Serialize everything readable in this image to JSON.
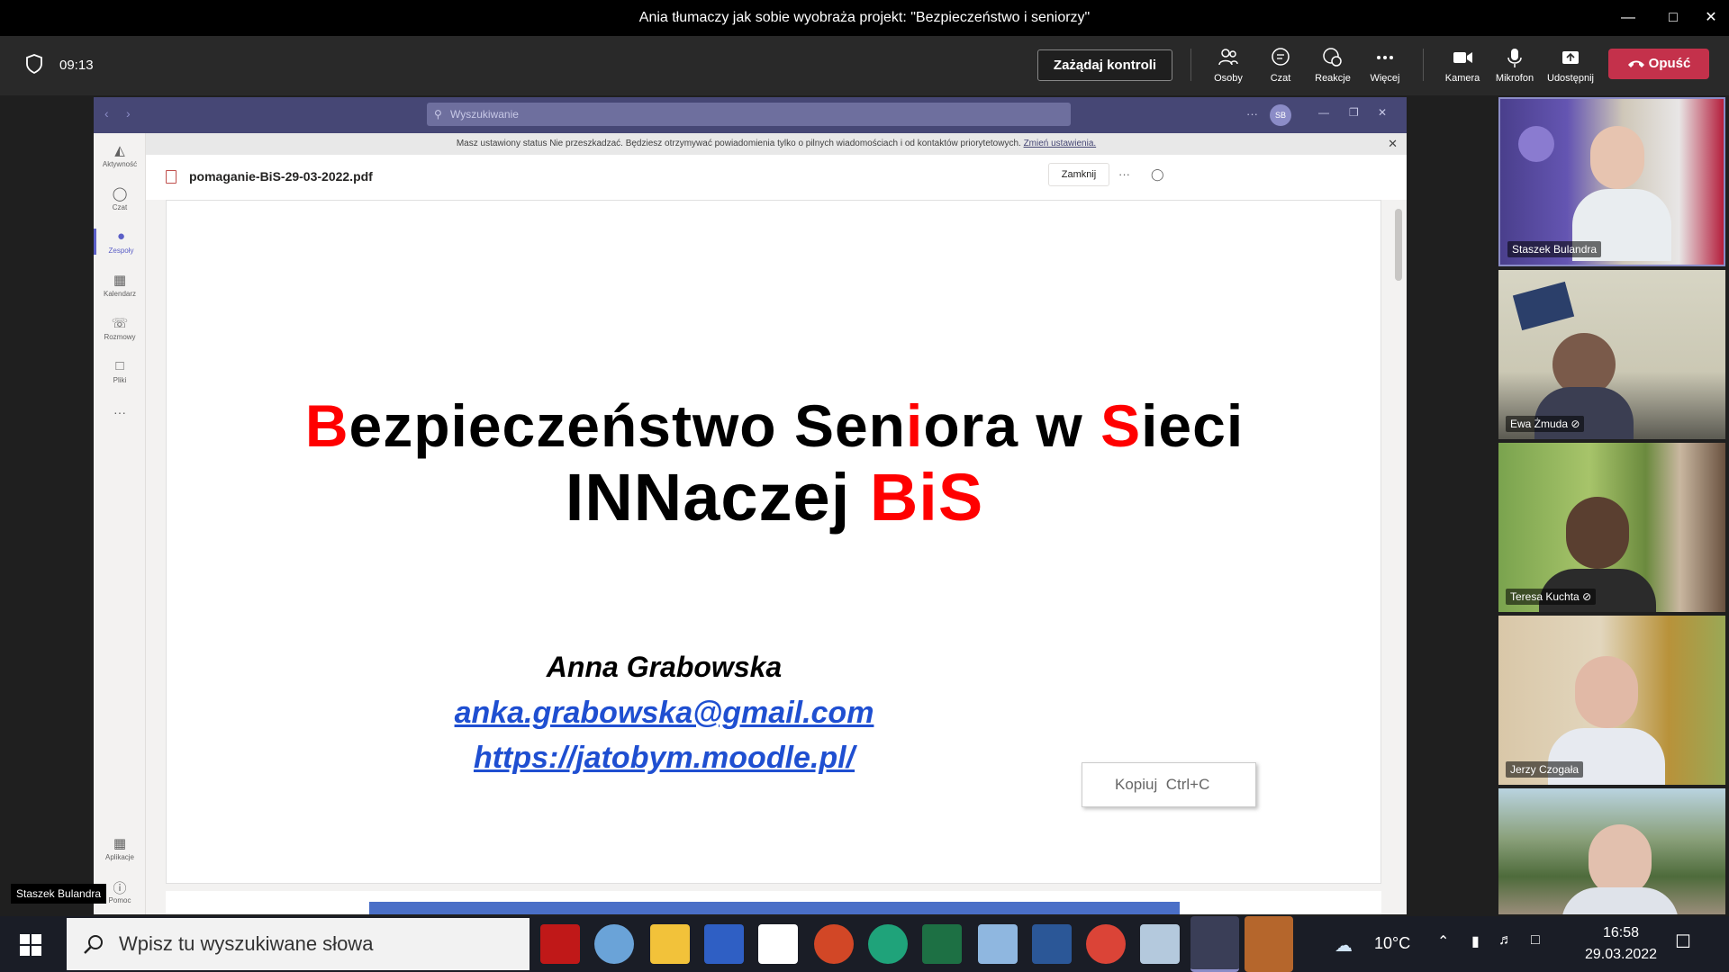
{
  "window": {
    "title": "Ania tłumaczy jak sobie wyobraża projekt: \"Bezpieczeństwo i seniorzy\""
  },
  "meeting": {
    "timer": "09:13",
    "control_request": "Zażądaj kontroli",
    "buttons": [
      {
        "label": "Osoby",
        "icon": "people-icon"
      },
      {
        "label": "Czat",
        "icon": "chat-icon"
      },
      {
        "label": "Reakcje",
        "icon": "reactions-icon"
      },
      {
        "label": "Więcej",
        "icon": "more-icon"
      },
      {
        "label": "Kamera",
        "icon": "camera-icon"
      },
      {
        "label": "Mikrofon",
        "icon": "microphone-icon"
      },
      {
        "label": "Udostępnij",
        "icon": "share-icon"
      }
    ],
    "leave": "Opuść",
    "leave_color": "#c4314b"
  },
  "teams": {
    "search_placeholder": "Wyszukiwanie",
    "avatar_initials": "SB",
    "rail": [
      {
        "label": "Aktywność",
        "icon": "bell-icon"
      },
      {
        "label": "Czat",
        "icon": "chat-icon"
      },
      {
        "label": "Zespoły",
        "icon": "teams-icon",
        "active": true
      },
      {
        "label": "Kalendarz",
        "icon": "calendar-icon"
      },
      {
        "label": "Rozmowy",
        "icon": "phone-icon"
      },
      {
        "label": "Pliki",
        "icon": "file-icon"
      }
    ],
    "rail_bottom": [
      {
        "label": "Aplikacje",
        "icon": "apps-icon"
      },
      {
        "label": "Pomoc",
        "icon": "help-icon"
      }
    ],
    "notice": "Masz ustawiony status Nie przeszkadzać. Będziesz otrzymywać powiadomienia tylko o pilnych wiadomościach i od kontaktów priorytetowych.",
    "notice_link": "Zmień ustawienia.",
    "file_name": "pomaganie-BiS-29-03-2022.pdf",
    "close_button": "Zamknij",
    "accent": "#464775"
  },
  "slide": {
    "line1": [
      {
        "text": "B",
        "red": true
      },
      {
        "text": "ezpieczeństwo Sen",
        "red": false
      },
      {
        "text": "i",
        "red": true
      },
      {
        "text": "ora w ",
        "red": false
      },
      {
        "text": "S",
        "red": true
      },
      {
        "text": "ieci",
        "red": false
      }
    ],
    "line2_black": "INNaczej ",
    "line2_red": "BiS",
    "author": "Anna Grabowska",
    "email": "anka.grabowska@gmail.com",
    "url": "https://jatobym.moodle.pl/",
    "red_color": "#ff0000",
    "link_color": "#1f4fd1"
  },
  "context_menu": {
    "label": "Kopiuj",
    "shortcut": "Ctrl+C"
  },
  "presenter_label": "Staszek Bulandra",
  "participants": [
    {
      "name": "Staszek Bulandra",
      "muted": false,
      "active": true
    },
    {
      "name": "Ewa Żmuda",
      "muted": true
    },
    {
      "name": "Teresa Kuchta",
      "muted": true
    },
    {
      "name": "Jerzy Czogała",
      "muted": false
    },
    {
      "name": "",
      "muted": false
    }
  ],
  "taskbar": {
    "search_placeholder": "Wpisz tu wyszukiwane słowa",
    "weather": "10°C",
    "time": "16:58",
    "date": "29.03.2022",
    "apps": [
      "mcafee-icon",
      "network-globe-icon",
      "file-explorer-icon",
      "save-icon",
      "store-icon",
      "powerpoint-icon",
      "edge-icon",
      "excel-icon",
      "paint-icon",
      "word-icon",
      "chrome-icon",
      "paint-3d-icon",
      "teams-icon",
      "waves-icon"
    ]
  }
}
